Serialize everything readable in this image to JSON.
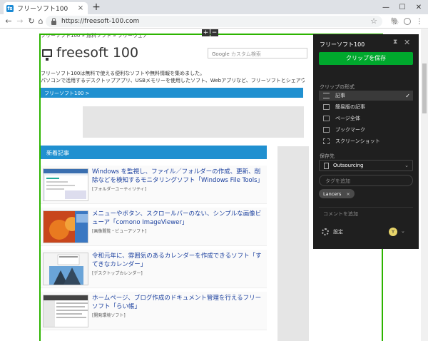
{
  "browser": {
    "tab_title": "フリーソフト100",
    "tab_favicon": "fs",
    "close_tab": "×",
    "new_tab": "+",
    "win_min": "—",
    "win_max": "☐",
    "win_close": "✕",
    "url": "https://freesoft-100.com",
    "back": "←",
    "forward": "→",
    "reload": "↻",
    "home": "⌂",
    "star": "☆",
    "menu": "⋮"
  },
  "page": {
    "breadcrumb": "フリーソフト100 » 無料ソフト » フリーウェア",
    "logo_text": "freesoft 100",
    "search_google": "Google",
    "search_placeholder": "カスタム検索",
    "intro_line1": "フリーソフト100は無料で使える便利なソフトや無料情報を集めました。",
    "intro_line2": "パソコンで活用するデスクトップアプリ、USBメモリーを使用したソフト、Webアプリなど、フリーソフトとシェアウェア情報を紹介し",
    "blue_bar": "フリーソフト100 >",
    "section_head": "新着記事",
    "zoom_plus": "+",
    "zoom_minus": "−",
    "articles": [
      {
        "title": "Windows を監視し、ファイル／フォルダーの作成、更新、削除などを検知するモニタリングソフト「Windows File Tools」",
        "category": "[フォルダーユーティリティ]"
      },
      {
        "title": "メニューやボタン、スクロールバーのない、シンプルな画像ビューア「comono ImageViewer」",
        "category": "[画像閲覧・ビューアソフト]"
      },
      {
        "title": "令和元年に、雰囲気のあるカレンダーを作成できるソフト「すてきなカレンダー」",
        "category": "[デスクトップカレンダー]"
      },
      {
        "title": "ホームページ、ブログ作成のドキュメント管理を行えるフリーソフト「らい帳」",
        "category": "[開発環境ソフト]"
      }
    ]
  },
  "evernote": {
    "title": "フリーソフト100",
    "pin": "⧗",
    "close": "✕",
    "save_button": "クリップを保存",
    "format_label": "クリップの形式",
    "formats": [
      {
        "label": "記事",
        "selected": true,
        "check": "✓"
      },
      {
        "label": "簡易版の記事"
      },
      {
        "label": "ページ全体"
      },
      {
        "label": "ブックマーク"
      },
      {
        "label": "スクリーンショット"
      }
    ],
    "save_to_label": "保存先",
    "notebook": "Outsourcing",
    "notebook_chev": "⌄",
    "tag_placeholder": "タグを追加",
    "tag": "Lancers",
    "tag_x": "×",
    "comment_placeholder": "コメントを追加",
    "settings": "設定",
    "avatar_letter": "Y",
    "avatar_chev": "⌄"
  },
  "colors": {
    "accent_green": "#00a82d",
    "clip_frame": "#2db400",
    "site_blue": "#2090d0",
    "link_blue": "#1a3f9e",
    "panel_bg": "#1f1f1f"
  }
}
